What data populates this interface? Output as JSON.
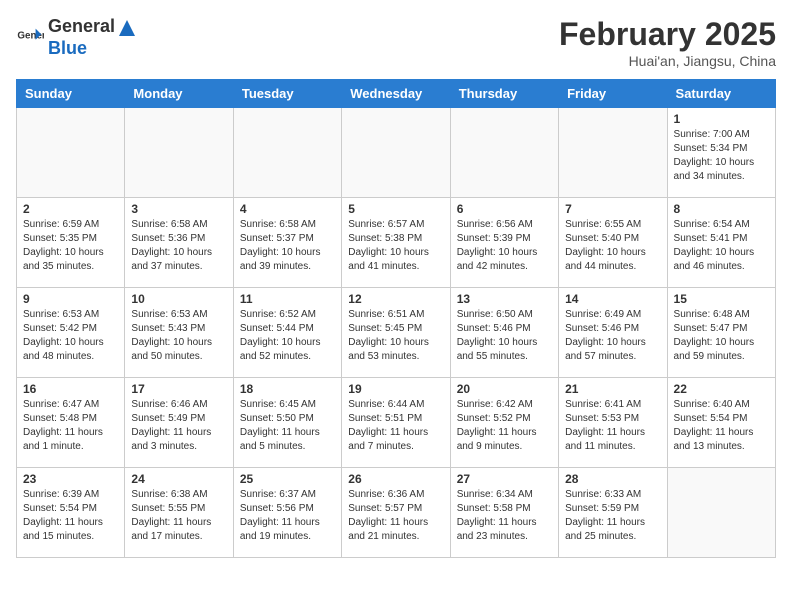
{
  "header": {
    "logo_general": "General",
    "logo_blue": "Blue",
    "month_year": "February 2025",
    "location": "Huai'an, Jiangsu, China"
  },
  "weekdays": [
    "Sunday",
    "Monday",
    "Tuesday",
    "Wednesday",
    "Thursday",
    "Friday",
    "Saturday"
  ],
  "weeks": [
    [
      {
        "day": "",
        "info": ""
      },
      {
        "day": "",
        "info": ""
      },
      {
        "day": "",
        "info": ""
      },
      {
        "day": "",
        "info": ""
      },
      {
        "day": "",
        "info": ""
      },
      {
        "day": "",
        "info": ""
      },
      {
        "day": "1",
        "info": "Sunrise: 7:00 AM\nSunset: 5:34 PM\nDaylight: 10 hours\nand 34 minutes."
      }
    ],
    [
      {
        "day": "2",
        "info": "Sunrise: 6:59 AM\nSunset: 5:35 PM\nDaylight: 10 hours\nand 35 minutes."
      },
      {
        "day": "3",
        "info": "Sunrise: 6:58 AM\nSunset: 5:36 PM\nDaylight: 10 hours\nand 37 minutes."
      },
      {
        "day": "4",
        "info": "Sunrise: 6:58 AM\nSunset: 5:37 PM\nDaylight: 10 hours\nand 39 minutes."
      },
      {
        "day": "5",
        "info": "Sunrise: 6:57 AM\nSunset: 5:38 PM\nDaylight: 10 hours\nand 41 minutes."
      },
      {
        "day": "6",
        "info": "Sunrise: 6:56 AM\nSunset: 5:39 PM\nDaylight: 10 hours\nand 42 minutes."
      },
      {
        "day": "7",
        "info": "Sunrise: 6:55 AM\nSunset: 5:40 PM\nDaylight: 10 hours\nand 44 minutes."
      },
      {
        "day": "8",
        "info": "Sunrise: 6:54 AM\nSunset: 5:41 PM\nDaylight: 10 hours\nand 46 minutes."
      }
    ],
    [
      {
        "day": "9",
        "info": "Sunrise: 6:53 AM\nSunset: 5:42 PM\nDaylight: 10 hours\nand 48 minutes."
      },
      {
        "day": "10",
        "info": "Sunrise: 6:53 AM\nSunset: 5:43 PM\nDaylight: 10 hours\nand 50 minutes."
      },
      {
        "day": "11",
        "info": "Sunrise: 6:52 AM\nSunset: 5:44 PM\nDaylight: 10 hours\nand 52 minutes."
      },
      {
        "day": "12",
        "info": "Sunrise: 6:51 AM\nSunset: 5:45 PM\nDaylight: 10 hours\nand 53 minutes."
      },
      {
        "day": "13",
        "info": "Sunrise: 6:50 AM\nSunset: 5:46 PM\nDaylight: 10 hours\nand 55 minutes."
      },
      {
        "day": "14",
        "info": "Sunrise: 6:49 AM\nSunset: 5:46 PM\nDaylight: 10 hours\nand 57 minutes."
      },
      {
        "day": "15",
        "info": "Sunrise: 6:48 AM\nSunset: 5:47 PM\nDaylight: 10 hours\nand 59 minutes."
      }
    ],
    [
      {
        "day": "16",
        "info": "Sunrise: 6:47 AM\nSunset: 5:48 PM\nDaylight: 11 hours\nand 1 minute."
      },
      {
        "day": "17",
        "info": "Sunrise: 6:46 AM\nSunset: 5:49 PM\nDaylight: 11 hours\nand 3 minutes."
      },
      {
        "day": "18",
        "info": "Sunrise: 6:45 AM\nSunset: 5:50 PM\nDaylight: 11 hours\nand 5 minutes."
      },
      {
        "day": "19",
        "info": "Sunrise: 6:44 AM\nSunset: 5:51 PM\nDaylight: 11 hours\nand 7 minutes."
      },
      {
        "day": "20",
        "info": "Sunrise: 6:42 AM\nSunset: 5:52 PM\nDaylight: 11 hours\nand 9 minutes."
      },
      {
        "day": "21",
        "info": "Sunrise: 6:41 AM\nSunset: 5:53 PM\nDaylight: 11 hours\nand 11 minutes."
      },
      {
        "day": "22",
        "info": "Sunrise: 6:40 AM\nSunset: 5:54 PM\nDaylight: 11 hours\nand 13 minutes."
      }
    ],
    [
      {
        "day": "23",
        "info": "Sunrise: 6:39 AM\nSunset: 5:54 PM\nDaylight: 11 hours\nand 15 minutes."
      },
      {
        "day": "24",
        "info": "Sunrise: 6:38 AM\nSunset: 5:55 PM\nDaylight: 11 hours\nand 17 minutes."
      },
      {
        "day": "25",
        "info": "Sunrise: 6:37 AM\nSunset: 5:56 PM\nDaylight: 11 hours\nand 19 minutes."
      },
      {
        "day": "26",
        "info": "Sunrise: 6:36 AM\nSunset: 5:57 PM\nDaylight: 11 hours\nand 21 minutes."
      },
      {
        "day": "27",
        "info": "Sunrise: 6:34 AM\nSunset: 5:58 PM\nDaylight: 11 hours\nand 23 minutes."
      },
      {
        "day": "28",
        "info": "Sunrise: 6:33 AM\nSunset: 5:59 PM\nDaylight: 11 hours\nand 25 minutes."
      },
      {
        "day": "",
        "info": ""
      }
    ]
  ]
}
